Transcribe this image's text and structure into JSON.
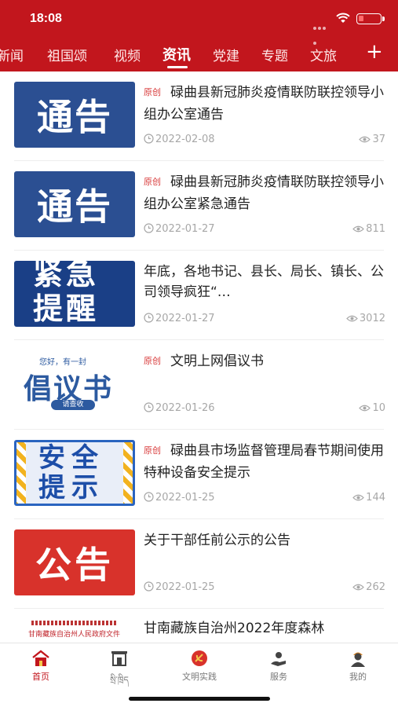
{
  "status_bar": {
    "time": "18:08"
  },
  "tabs": [
    {
      "label": "新闻"
    },
    {
      "label": "祖国颂"
    },
    {
      "label": "视频"
    },
    {
      "label": "资讯"
    },
    {
      "label": "党建"
    },
    {
      "label": "专题"
    },
    {
      "label": "文旅"
    }
  ],
  "active_tab": "资讯",
  "add_button": "+",
  "articles": [
    {
      "thumb_text": "通告",
      "badge": "原创",
      "title": "碌曲县新冠肺炎疫情联防联控领导小组办公室通告",
      "date": "2022-02-08",
      "views": "37"
    },
    {
      "thumb_text": "通告",
      "badge": "原创",
      "title": "碌曲县新冠肺炎疫情联防联控领导小组办公室紧急通告",
      "date": "2022-01-27",
      "views": "811"
    },
    {
      "thumb_text_1": "紧急",
      "thumb_text_2": "提醒",
      "badge": "",
      "title": "年底，各地书记、县长、局长、镇长、公司领导疯狂“…",
      "date": "2022-01-27",
      "views": "3012"
    },
    {
      "thumb_small": "您好，有一封",
      "thumb_text": "倡议书",
      "thumb_btn": "请查收",
      "badge": "原创",
      "title": "文明上网倡议书",
      "date": "2022-01-26",
      "views": "10"
    },
    {
      "thumb_text_1": "安全",
      "thumb_text_2": "提示",
      "badge": "原创",
      "title": "碌曲县市场监督管理局春节期间使用特种设备安全提示",
      "date": "2022-01-25",
      "views": "144"
    },
    {
      "thumb_text": "公告",
      "badge": "",
      "title": "关于干部任前公示的公告",
      "date": "2022-01-25",
      "views": "262"
    },
    {
      "thumb_text": "甘南藏族自治州人民政府文件",
      "badge": "",
      "title": "甘南藏族自治州2022年度森林",
      "date": "",
      "views": ""
    }
  ],
  "bottom_nav": [
    {
      "label": "首页",
      "icon": "home-icon"
    },
    {
      "label": "སྲི་ཁྲིད",
      "icon": "gate-icon"
    },
    {
      "label": "文明实践",
      "icon": "party-emblem-icon"
    },
    {
      "label": "服务",
      "icon": "service-hand-icon"
    },
    {
      "label": "我的",
      "icon": "profile-icon"
    }
  ],
  "colors": {
    "brand_red": "#c2161d",
    "badge_red": "#d83a3a",
    "meta_gray": "#a7a7a7"
  }
}
